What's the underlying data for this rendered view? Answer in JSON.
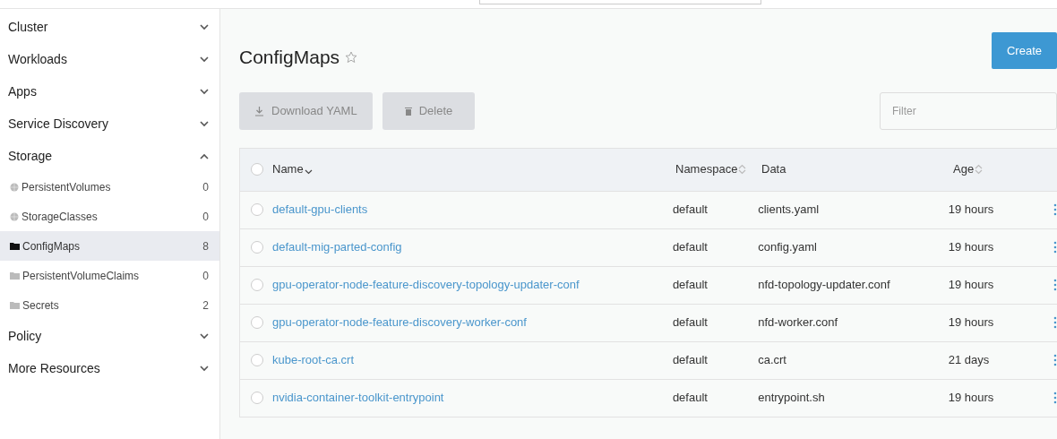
{
  "sidebar": {
    "groups": [
      {
        "label": "Cluster",
        "expanded": false
      },
      {
        "label": "Workloads",
        "expanded": false
      },
      {
        "label": "Apps",
        "expanded": false
      },
      {
        "label": "Service Discovery",
        "expanded": false
      },
      {
        "label": "Storage",
        "expanded": true,
        "children": [
          {
            "label": "PersistentVolumes",
            "count": "0",
            "kind": "globe",
            "selected": false
          },
          {
            "label": "StorageClasses",
            "count": "0",
            "kind": "globe",
            "selected": false
          },
          {
            "label": "ConfigMaps",
            "count": "8",
            "kind": "folder",
            "selected": true
          },
          {
            "label": "PersistentVolumeClaims",
            "count": "0",
            "kind": "folder",
            "selected": false
          },
          {
            "label": "Secrets",
            "count": "2",
            "kind": "folder",
            "selected": false
          }
        ]
      },
      {
        "label": "Policy",
        "expanded": false
      },
      {
        "label": "More Resources",
        "expanded": false
      }
    ]
  },
  "page": {
    "title": "ConfigMaps",
    "create_button": "Create",
    "actions": [
      {
        "label": "Download YAML",
        "kind": "download",
        "disabled": true
      },
      {
        "label": "Delete",
        "kind": "delete",
        "disabled": true
      }
    ],
    "filter": {
      "placeholder": "Filter"
    }
  },
  "table": {
    "all_checked": false,
    "columns": [
      {
        "label": "Name",
        "sorted": true
      },
      {
        "label": "Namespace",
        "sorted": false
      },
      {
        "label": "Data"
      },
      {
        "label": "Age",
        "sorted": false
      }
    ],
    "rows": [
      {
        "name": "default-gpu-clients",
        "namespace": "default",
        "data": "clients.yaml",
        "age": "19 hours",
        "checked": false
      },
      {
        "name": "default-mig-parted-config",
        "namespace": "default",
        "data": "config.yaml",
        "age": "19 hours",
        "checked": false
      },
      {
        "name": "gpu-operator-node-feature-discovery-topology-updater-conf",
        "namespace": "default",
        "data": "nfd-topology-updater.conf",
        "age": "19 hours",
        "checked": false
      },
      {
        "name": "gpu-operator-node-feature-discovery-worker-conf",
        "namespace": "default",
        "data": "nfd-worker.conf",
        "age": "19 hours",
        "checked": false
      },
      {
        "name": "kube-root-ca.crt",
        "namespace": "default",
        "data": "ca.crt",
        "age": "21 days",
        "checked": false
      },
      {
        "name": "nvidia-container-toolkit-entrypoint",
        "namespace": "default",
        "data": "entrypoint.sh",
        "age": "19 hours",
        "checked": false
      }
    ]
  }
}
